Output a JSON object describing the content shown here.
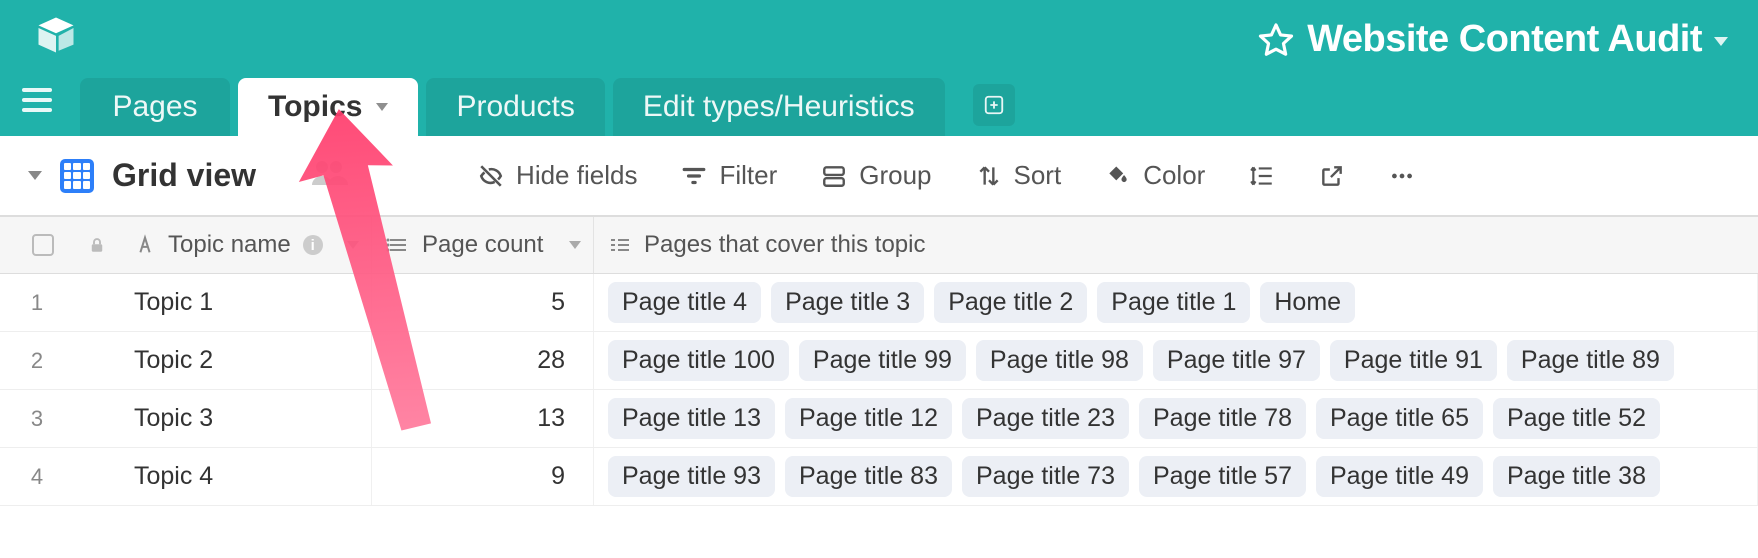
{
  "base": {
    "title": "Website Content Audit",
    "starred": false
  },
  "tabs": [
    {
      "label": "Pages",
      "active": false
    },
    {
      "label": "Topics",
      "active": true
    },
    {
      "label": "Products",
      "active": false
    },
    {
      "label": "Edit types/Heuristics",
      "active": false
    }
  ],
  "view": {
    "name": "Grid view"
  },
  "toolbar": {
    "hide_fields": "Hide fields",
    "filter": "Filter",
    "group": "Group",
    "sort": "Sort",
    "color": "Color"
  },
  "columns": {
    "topic_name": "Topic name",
    "page_count": "Page count",
    "pages_cover": "Pages that cover this topic"
  },
  "rows": [
    {
      "n": "1",
      "name": "Topic 1",
      "count": "5",
      "pages": [
        "Page title 4",
        "Page title 3",
        "Page title 2",
        "Page title 1",
        "Home"
      ]
    },
    {
      "n": "2",
      "name": "Topic 2",
      "count": "28",
      "pages": [
        "Page title 100",
        "Page title 99",
        "Page title 98",
        "Page title 97",
        "Page title 91",
        "Page title 89"
      ]
    },
    {
      "n": "3",
      "name": "Topic 3",
      "count": "13",
      "pages": [
        "Page title 13",
        "Page title 12",
        "Page title 23",
        "Page title 78",
        "Page title 65",
        "Page title 52"
      ]
    },
    {
      "n": "4",
      "name": "Topic 4",
      "count": "9",
      "pages": [
        "Page title 93",
        "Page title 83",
        "Page title 73",
        "Page title 57",
        "Page title 49",
        "Page title 38"
      ]
    }
  ],
  "colors": {
    "brand": "#20b2aa",
    "pill_bg": "#eceff5"
  },
  "annotation": {
    "type": "arrow",
    "target": "tab-topics"
  }
}
